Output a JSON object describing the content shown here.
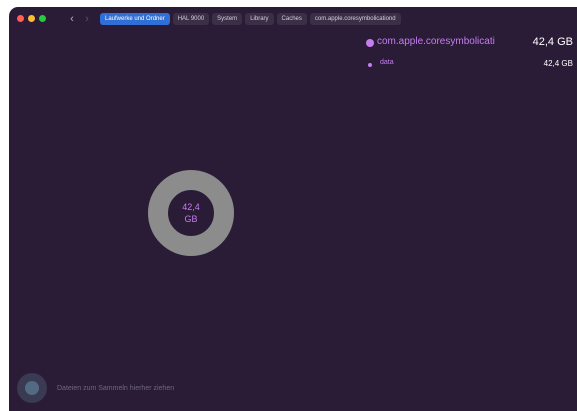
{
  "titlebar": {
    "nav_back": "‹",
    "nav_forward": "›",
    "breadcrumbs": [
      "Laufwerke und Ordner",
      "HAL 9000",
      "System",
      "Library",
      "Caches",
      "com.apple.coresymbolicationd"
    ]
  },
  "legend": {
    "items": [
      {
        "name": "com.apple.coresymbolicati",
        "size": "42,4 GB"
      },
      {
        "name": "data",
        "size": "42,4 GB"
      }
    ]
  },
  "chart": {
    "label_value": "42,4",
    "label_unit": "GB",
    "ring_fraction": 1.0,
    "ring_color": "#8c8c8c",
    "accent_color": "#c57df0"
  },
  "footer": {
    "hint": "Dateien zum Sammeln hierher ziehen"
  }
}
